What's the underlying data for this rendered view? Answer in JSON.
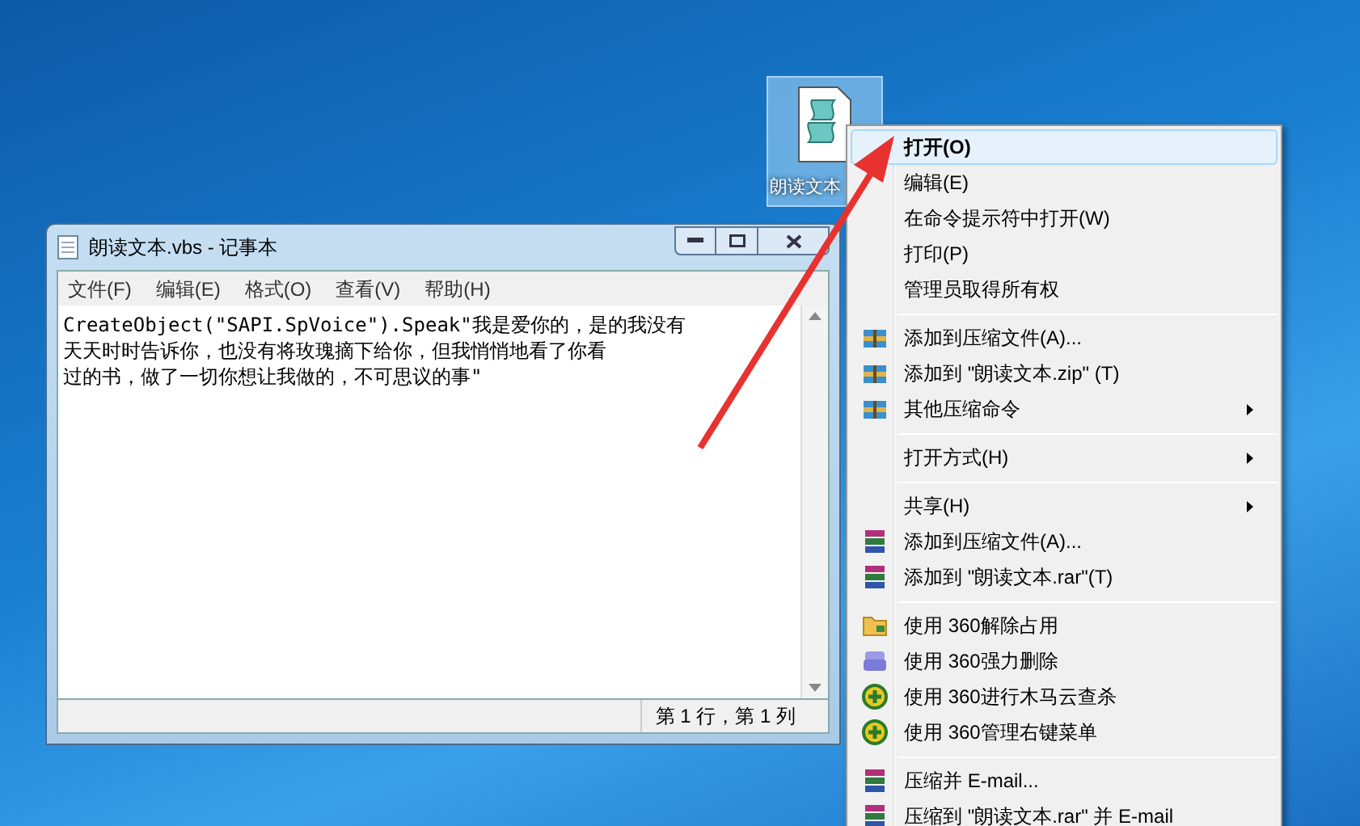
{
  "desktop_icon": {
    "label": "朗读文本",
    "selected": true
  },
  "notepad": {
    "title": "朗读文本.vbs - 记事本",
    "menu": [
      "文件(F)",
      "编辑(E)",
      "格式(O)",
      "查看(V)",
      "帮助(H)"
    ],
    "content_lines": [
      "CreateObject(\"SAPI.SpVoice\").Speak\"我是爱你的，是的我没有",
      "天天时时告诉你，也没有将玫瑰摘下给你，但我悄悄地看了你看",
      "过的书，做了一切你想让我做的，不可思议的事\""
    ],
    "status": "第 1 行，第 1 列"
  },
  "context_menu": [
    {
      "kind": "item",
      "label": "打开(O)",
      "selected": true,
      "submenu": false
    },
    {
      "kind": "item",
      "label": "编辑(E)",
      "selected": false,
      "submenu": false
    },
    {
      "kind": "item",
      "label": "在命令提示符中打开(W)",
      "selected": false,
      "submenu": false
    },
    {
      "kind": "item",
      "label": "打印(P)",
      "selected": false,
      "submenu": false
    },
    {
      "kind": "item",
      "label": "管理员取得所有权",
      "selected": false,
      "submenu": false
    },
    {
      "kind": "separator"
    },
    {
      "kind": "zip",
      "label": "添加到压缩文件(A)...",
      "selected": false,
      "submenu": false
    },
    {
      "kind": "zip",
      "label": "添加到 \"朗读文本.zip\" (T)",
      "selected": false,
      "submenu": false
    },
    {
      "kind": "zip",
      "label": "其他压缩命令",
      "selected": false,
      "submenu": true
    },
    {
      "kind": "separator"
    },
    {
      "kind": "item",
      "label": "打开方式(H)",
      "selected": false,
      "submenu": true
    },
    {
      "kind": "separator"
    },
    {
      "kind": "item",
      "label": "共享(H)",
      "selected": false,
      "submenu": true
    },
    {
      "kind": "rar",
      "label": "添加到压缩文件(A)...",
      "selected": false,
      "submenu": false
    },
    {
      "kind": "rar",
      "label": "添加到 \"朗读文本.rar\"(T)",
      "selected": false,
      "submenu": false
    },
    {
      "kind": "separator"
    },
    {
      "kind": "unlock",
      "label": "使用 360解除占用",
      "selected": false,
      "submenu": false
    },
    {
      "kind": "shred",
      "label": "使用 360强力删除",
      "selected": false,
      "submenu": false
    },
    {
      "kind": "guard",
      "label": "使用 360进行木马云查杀",
      "selected": false,
      "submenu": false
    },
    {
      "kind": "guard",
      "label": "使用 360管理右键菜单",
      "selected": false,
      "submenu": false
    },
    {
      "kind": "separator"
    },
    {
      "kind": "rar",
      "label": "压缩并 E-mail...",
      "selected": false,
      "submenu": false
    },
    {
      "kind": "rar",
      "label": "压缩到 \"朗读文本.rar\" 并 E-mail",
      "selected": false,
      "submenu": false
    }
  ]
}
